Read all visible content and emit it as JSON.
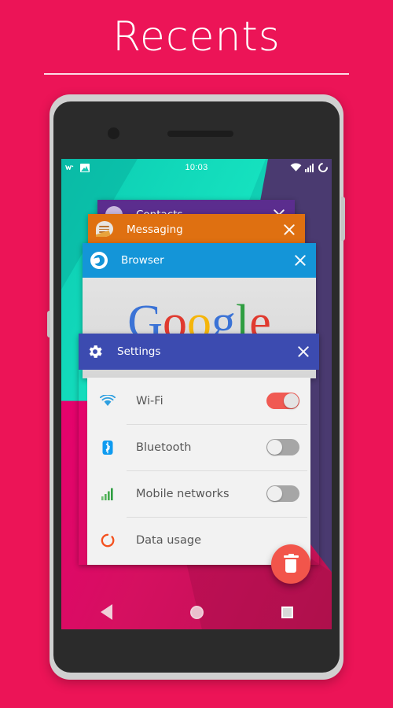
{
  "header": {
    "title": "Recents"
  },
  "phone": {
    "status_bar": {
      "time": "10:03",
      "left_icons": [
        "walkman-icon",
        "photo-icon"
      ],
      "right_icons": [
        "wifi-icon",
        "signal-icon",
        "battery-icon"
      ]
    },
    "nav_bar": {
      "back": "back-button",
      "home": "home-button",
      "recents": "recents-button"
    },
    "fab": {
      "name": "clear-all-button",
      "icon": "trash-icon",
      "color": "#f2554b"
    },
    "recents_cards": [
      {
        "title": "Contacts",
        "icon": "contacts-avatar-icon",
        "color": "#5b2d8e",
        "close_label": "close-contacts"
      },
      {
        "title": "Messaging",
        "icon": "message-bubble-icon",
        "color": "#df7011",
        "close_label": "close-messaging"
      },
      {
        "title": "Browser",
        "icon": "globe-icon",
        "color": "#1495d8",
        "close_label": "close-browser",
        "preview": {
          "logo_letters": [
            "G",
            "o",
            "o",
            "g",
            "l",
            "e"
          ],
          "logo_colors": [
            "#3b73d6",
            "#e03a2f",
            "#f5b50a",
            "#3b73d6",
            "#2f9e41",
            "#e03a2f"
          ]
        }
      },
      {
        "title": "Settings",
        "icon": "gear-icon",
        "color": "#3c4bb0",
        "close_label": "close-settings",
        "rows": [
          {
            "label": "Wi-Fi",
            "icon": "wifi-icon",
            "toggle": "on",
            "icon_color": "#2e9fe0"
          },
          {
            "label": "Bluetooth",
            "icon": "bluetooth-icon",
            "toggle": "off",
            "icon_color": "#0f9bf0"
          },
          {
            "label": "Mobile networks",
            "icon": "signal-icon",
            "toggle": "off",
            "icon_color": "#4caf50"
          },
          {
            "label": "Data usage",
            "icon": "data-usage-icon",
            "toggle": "none",
            "icon_color": "#f4511e"
          }
        ]
      }
    ]
  },
  "colors": {
    "page_background": "#ec1457",
    "toggle_on": "#f05a53",
    "toggle_off": "#a6a6a6",
    "wallpaper_teal": "#16e3c0",
    "wallpaper_purple": "#4a3a70",
    "wallpaper_pink": "#d51060"
  }
}
